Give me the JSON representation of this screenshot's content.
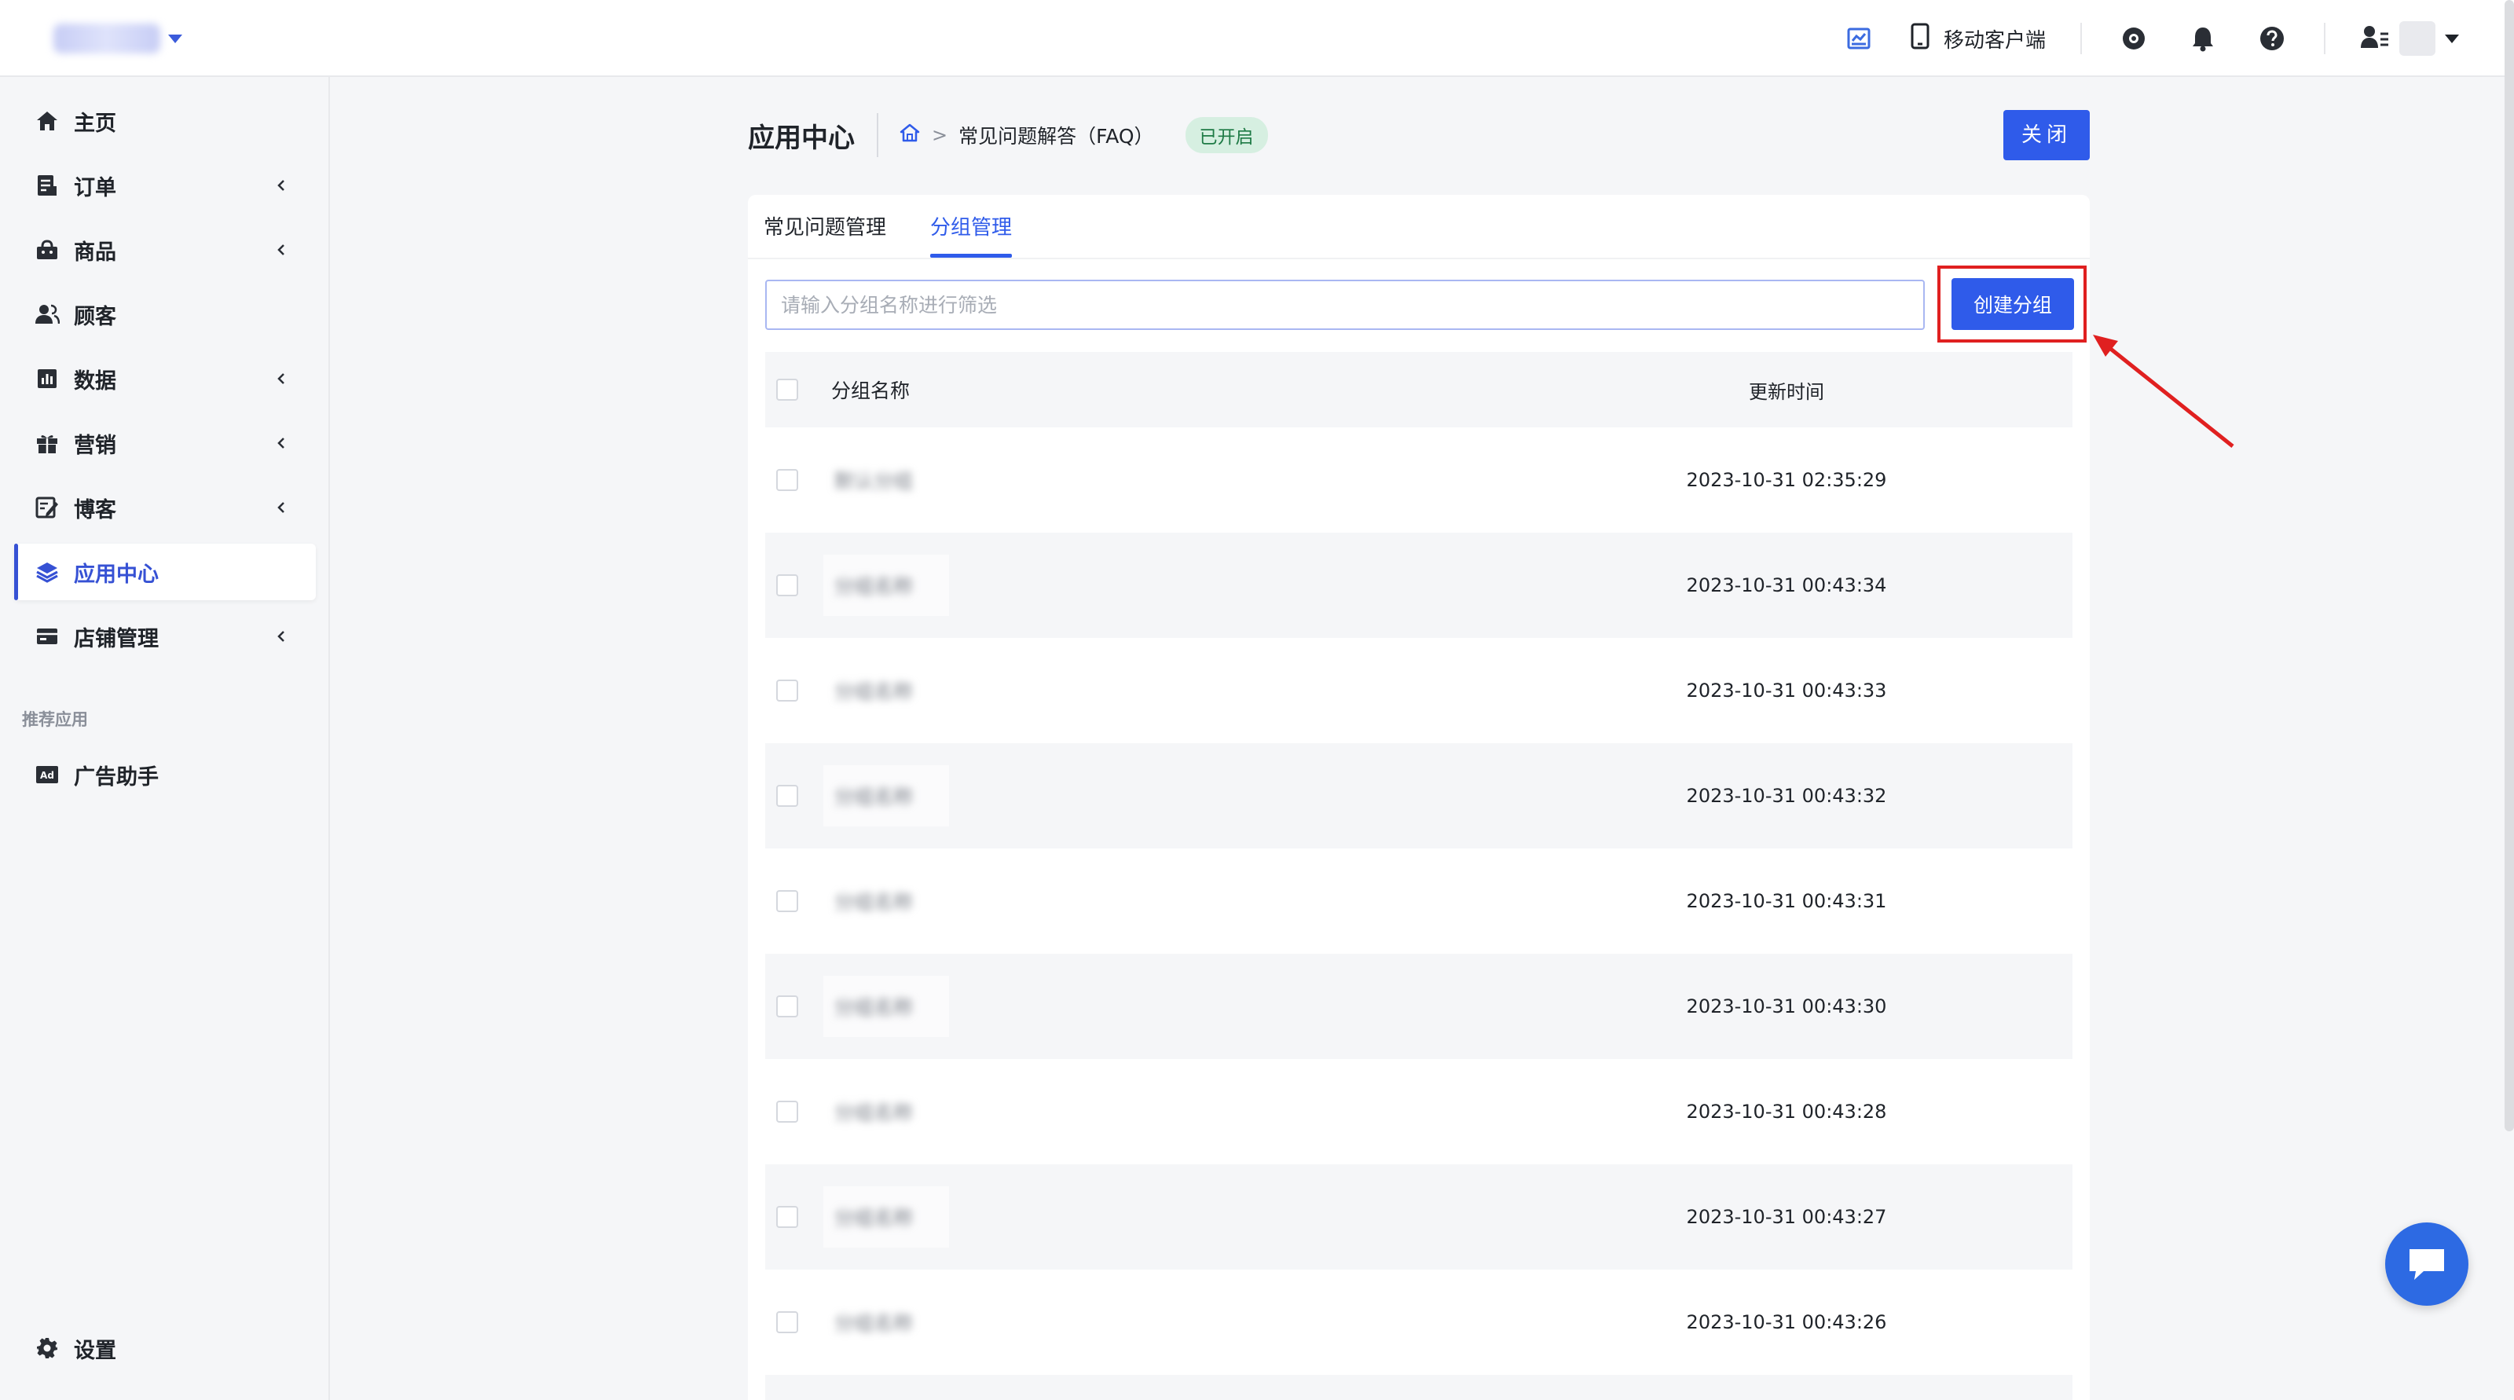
{
  "topbar": {
    "store_name": "店铺名称",
    "mobile_client_label": "移动客户端",
    "icons": [
      "dashboard-icon",
      "mobile-phone-icon",
      "eye-icon",
      "bell-icon",
      "help-icon",
      "user-icon"
    ]
  },
  "sidebar": {
    "items": [
      {
        "label": "主页",
        "icon": "home-icon",
        "has_children": false
      },
      {
        "label": "订单",
        "icon": "order-icon",
        "has_children": true
      },
      {
        "label": "商品",
        "icon": "product-icon",
        "has_children": true
      },
      {
        "label": "顾客",
        "icon": "customer-icon",
        "has_children": false
      },
      {
        "label": "数据",
        "icon": "data-icon",
        "has_children": true
      },
      {
        "label": "营销",
        "icon": "marketing-icon",
        "has_children": true
      },
      {
        "label": "博客",
        "icon": "blog-icon",
        "has_children": true
      },
      {
        "label": "应用中心",
        "icon": "layers-icon",
        "has_children": false,
        "active": true
      },
      {
        "label": "店铺管理",
        "icon": "store-icon",
        "has_children": true
      }
    ],
    "recommended_title": "推荐应用",
    "recommended": [
      {
        "label": "广告助手",
        "icon": "ad-icon"
      }
    ],
    "settings_label": "设置"
  },
  "header": {
    "title": "应用中心",
    "breadcrumb_separator": ">",
    "breadcrumb_current": "常见问题解答（FAQ）",
    "status": "已开启",
    "close_label": "关闭"
  },
  "tabs": [
    {
      "label": "常见问题管理",
      "active": false
    },
    {
      "label": "分组管理",
      "active": true
    }
  ],
  "filter": {
    "placeholder": "请输入分组名称进行筛选",
    "value": ""
  },
  "create_button_label": "创建分组",
  "table": {
    "columns": {
      "name": "分组名称",
      "updated": "更新时间"
    },
    "rows": [
      {
        "name": "默认分组",
        "updated": "2023-10-31 02:35:29"
      },
      {
        "name": "分组名称",
        "updated": "2023-10-31 00:43:34"
      },
      {
        "name": "分组名称",
        "updated": "2023-10-31 00:43:33"
      },
      {
        "name": "分组名称",
        "updated": "2023-10-31 00:43:32"
      },
      {
        "name": "分组名称",
        "updated": "2023-10-31 00:43:31"
      },
      {
        "name": "分组名称",
        "updated": "2023-10-31 00:43:30"
      },
      {
        "name": "分组名称",
        "updated": "2023-10-31 00:43:28"
      },
      {
        "name": "分组名称",
        "updated": "2023-10-31 00:43:27"
      },
      {
        "name": "分组名称",
        "updated": "2023-10-31 00:43:26"
      }
    ]
  },
  "colors": {
    "accent": "#2f5bea",
    "highlight": "#e02020",
    "status_bg": "#d6efe1",
    "status_text": "#1e7a45"
  }
}
